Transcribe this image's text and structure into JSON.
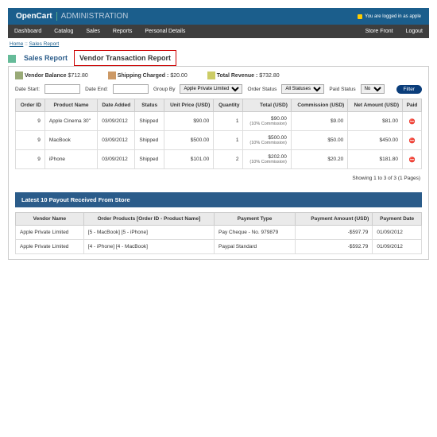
{
  "header": {
    "brand": "OpenCart",
    "sect": "ADMINISTRATION",
    "login": "You are logged in as apple"
  },
  "nav": {
    "items": [
      "Dashboard",
      "Catalog",
      "Sales",
      "Reports",
      "Personal Details"
    ],
    "right": [
      "Store Front",
      "Logout"
    ]
  },
  "bc": {
    "a": "Home",
    "b": "Sales Report"
  },
  "tabs": {
    "a": "Sales Report",
    "b": "Vendor Transaction Report"
  },
  "summary": {
    "balL": "Vendor Balance",
    "balV": "$712.80",
    "shipL": "Shipping Charged :",
    "shipV": "$20.00",
    "revL": "Total Revenue :",
    "revV": "$732.80"
  },
  "filters": {
    "ds": "Date Start:",
    "de": "Date End:",
    "gb": "Group By",
    "gbv": "Apple Private Limited",
    "os": "Order Status",
    "osv": "All Statuses",
    "ps": "Paid Status",
    "psv": "No",
    "btn": "Filter"
  },
  "th": {
    "oid": "Order ID",
    "pn": "Product Name",
    "da": "Date Added",
    "st": "Status",
    "up": "Unit Price (USD)",
    "qty": "Quantity",
    "tot": "Total (USD)",
    "com": "Commission (USD)",
    "net": "Net Amount (USD)",
    "pd": "Paid"
  },
  "rows": [
    {
      "oid": "9",
      "pn": "Apple Cinema 30\"",
      "da": "03/09/2012",
      "st": "Shipped",
      "up": "$90.00",
      "qty": "1",
      "tot": "$90.00",
      "tc": "(10% Commission)",
      "com": "$9.00",
      "net": "$81.00"
    },
    {
      "oid": "9",
      "pn": "MacBook",
      "da": "03/09/2012",
      "st": "Shipped",
      "up": "$500.00",
      "qty": "1",
      "tot": "$500.00",
      "tc": "(10% Commission)",
      "com": "$50.00",
      "net": "$450.00"
    },
    {
      "oid": "9",
      "pn": "iPhone",
      "da": "03/09/2012",
      "st": "Shipped",
      "up": "$101.00",
      "qty": "2",
      "tot": "$202.00",
      "tc": "(10% Commission)",
      "com": "$20.20",
      "net": "$181.80"
    }
  ],
  "pager": "Showing 1 to 3 of 3 (1 Pages)",
  "panel": "Latest 10 Payout Received From Store",
  "pth": {
    "vn": "Vendor Name",
    "op": "Order Products [Order ID - Product Name]",
    "pt": "Payment Type",
    "pa": "Payment Amount (USD)",
    "pd": "Payment Date"
  },
  "prows": [
    {
      "vn": "Apple Private Limited",
      "op": "[5 - MacBook] [5 - iPhone]",
      "pt": "Pay Cheque - No. 979879",
      "pa": "-$597.79",
      "pd": "01/09/2012"
    },
    {
      "vn": "Apple Private Limited",
      "op": "[4 - iPhone] [4 - MacBook]",
      "pt": "Paypal Standard",
      "pa": "-$592.79",
      "pd": "01/09/2012"
    }
  ]
}
